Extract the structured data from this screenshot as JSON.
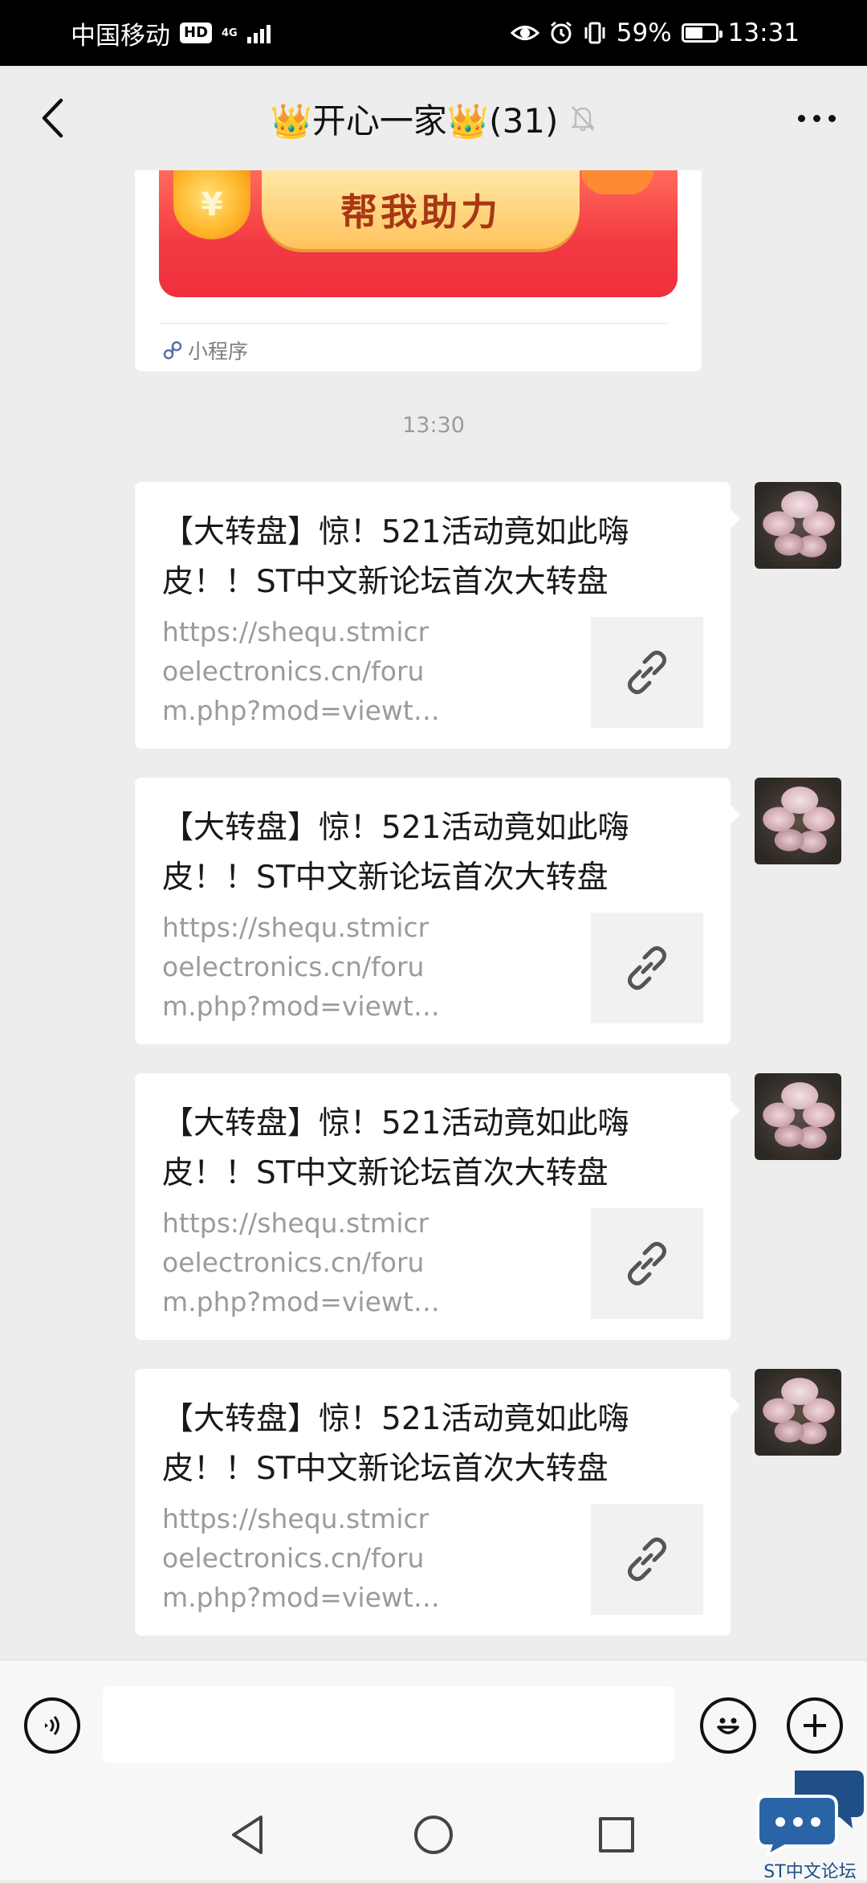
{
  "status_bar": {
    "carrier": "中国移动",
    "hd": "HD",
    "network": "4G",
    "battery": "59%",
    "battery_level": 0.59,
    "time": "13:31"
  },
  "header": {
    "title": "👑开心一家👑(31)"
  },
  "mini_program_card": {
    "button_label": "帮我助力",
    "coin_symbol": "¥",
    "source_label": "小程序"
  },
  "timestamp": "13:30",
  "messages": [
    {
      "title": "【大转盘】惊！521活动竟如此嗨皮！！ST中文新论坛首次大转盘",
      "url": "https://shequ.stmicroelectronics.cn/forum.php?mod=viewthread&tid=..."
    },
    {
      "title": "【大转盘】惊！521活动竟如此嗨皮！！ST中文新论坛首次大转盘",
      "url": "https://shequ.stmicroelectronics.cn/forum.php?mod=viewthread&tid=..."
    },
    {
      "title": "【大转盘】惊！521活动竟如此嗨皮！！ST中文新论坛首次大转盘",
      "url": "https://shequ.stmicroelectronics.cn/forum.php?mod=viewthread&tid=..."
    },
    {
      "title": "【大转盘】惊！521活动竟如此嗨皮！！ST中文新论坛首次大转盘",
      "url": "https://shequ.stmicroelectronics.cn/forum.php?mod=viewthread&tid=..."
    }
  ],
  "input": {
    "value": ""
  },
  "watermark": {
    "text": "ST中文论坛"
  },
  "icons": {
    "back": "chevron-left-icon",
    "mute": "bell-off-icon",
    "more": "more-dots-icon",
    "link": "link-icon",
    "voice": "voice-icon",
    "emoji": "emoji-icon",
    "plus": "plus-icon",
    "mini_program": "mini-program-icon"
  },
  "colors": {
    "background": "#ededed",
    "card": "#ffffff",
    "banner_red": "#f33b42",
    "button_gold": "#ffc35d",
    "button_text": "#a83714",
    "muted_text": "#9b9b9b"
  }
}
